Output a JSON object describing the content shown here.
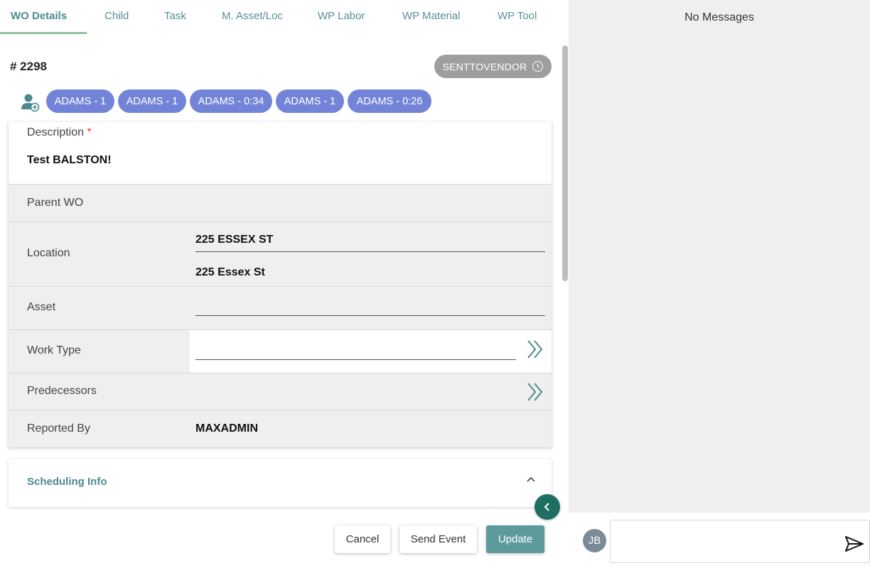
{
  "tabs": [
    "WO Details",
    "Child",
    "Task",
    "M. Asset/Loc",
    "WP Labor",
    "WP Material",
    "WP Tool"
  ],
  "wo_number": "# 2298",
  "status": {
    "label": "SENTTOVENDOR",
    "icon": "sync-icon",
    "color": "#9e9e9e"
  },
  "assign_icon": "user-add-icon",
  "labor_chips": [
    "ADAMS - 1",
    "ADAMS - 1",
    "ADAMS - 0:34",
    "ADAMS - 1",
    "ADAMS - 0:26"
  ],
  "fields": {
    "description": {
      "label": "Description",
      "required_mark": "*",
      "value": "Test BALSTON!"
    },
    "parent_wo": {
      "label": "Parent WO",
      "value": ""
    },
    "location": {
      "label": "Location",
      "value": "225 ESSEX ST",
      "description": "225 Essex St"
    },
    "asset": {
      "label": "Asset",
      "value": ""
    },
    "work_type": {
      "label": "Work Type",
      "value": "",
      "icon": "double-chevron-right-icon"
    },
    "predecessors": {
      "label": "Predecessors",
      "icon": "double-chevron-right-icon"
    },
    "reported_by": {
      "label": "Reported By",
      "value": "MAXADMIN"
    }
  },
  "sections": {
    "scheduling_info": "Scheduling Info"
  },
  "buttons": {
    "cancel": "Cancel",
    "send_event": "Send Event",
    "update": "Update"
  },
  "messages": {
    "empty_text": "No Messages",
    "avatar_initials": "JB",
    "input_placeholder": "",
    "send_icon": "send-icon"
  },
  "colors": {
    "accent": "#4d8a8f",
    "chip": "#7384d8",
    "update_button": "#5d9a9c",
    "required": "#e53935"
  }
}
